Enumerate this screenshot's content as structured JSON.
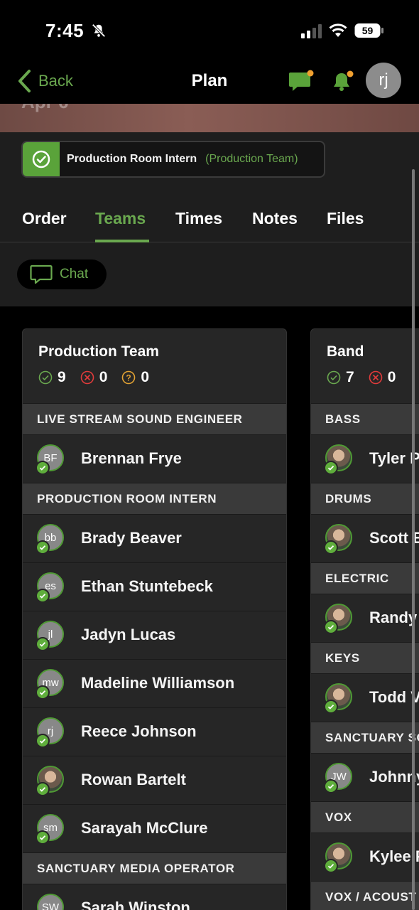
{
  "status_bar": {
    "time": "7:45",
    "battery": "59",
    "icons": [
      "bell-slash-icon",
      "signal-icon",
      "wifi-icon",
      "battery-icon"
    ]
  },
  "nav": {
    "back_label": "Back",
    "title": "Plan",
    "avatar_initials": "rj",
    "icons": [
      "chevron-left-icon",
      "chat-icon",
      "bell-icon"
    ]
  },
  "hero": {
    "date_label": "Apr 6"
  },
  "assignment": {
    "role": "Production Room Intern",
    "team": "(Production Team)"
  },
  "tabs": [
    {
      "label": "Order"
    },
    {
      "label": "Teams",
      "active": true
    },
    {
      "label": "Times"
    },
    {
      "label": "Notes"
    },
    {
      "label": "Files"
    }
  ],
  "chat_button": {
    "label": "Chat"
  },
  "colors": {
    "accent": "#6aa84f",
    "declined": "#e03b3b",
    "pending": "#e0a133",
    "background": "#1e1e1e",
    "card": "#262626",
    "section": "#3a3a3a"
  },
  "teams": [
    {
      "name": "Production Team",
      "counts": {
        "confirmed": "9",
        "declined": "0",
        "pending": "0"
      },
      "sections": [
        {
          "title": "LIVE STREAM SOUND ENGINEER",
          "people": [
            {
              "initials": "BF",
              "name": "Brennan Frye"
            }
          ]
        },
        {
          "title": "PRODUCTION ROOM INTERN",
          "people": [
            {
              "initials": "bb",
              "name": "Brady Beaver"
            },
            {
              "initials": "es",
              "name": "Ethan Stuntebeck"
            },
            {
              "initials": "jl",
              "name": "Jadyn Lucas"
            },
            {
              "initials": "mw",
              "name": "Madeline Williamson"
            },
            {
              "initials": "rj",
              "name": "Reece Johnson"
            },
            {
              "initials": "",
              "name": "Rowan Bartelt"
            },
            {
              "initials": "sm",
              "name": "Sarayah McClure"
            }
          ]
        },
        {
          "title": "SANCTUARY MEDIA OPERATOR",
          "people": [
            {
              "initials": "SW",
              "name": "Sarah Winston"
            }
          ]
        }
      ]
    },
    {
      "name": "Band",
      "counts": {
        "confirmed": "7",
        "declined": "0"
      },
      "sections": [
        {
          "title": "BASS",
          "people": [
            {
              "initials": "",
              "name": "Tyler P"
            }
          ]
        },
        {
          "title": "DRUMS",
          "people": [
            {
              "initials": "",
              "name": "Scott E"
            }
          ]
        },
        {
          "title": "ELECTRIC",
          "people": [
            {
              "initials": "",
              "name": "Randy"
            }
          ]
        },
        {
          "title": "KEYS",
          "people": [
            {
              "initials": "",
              "name": "Todd V"
            }
          ]
        },
        {
          "title": "SANCTUARY SO",
          "people": [
            {
              "initials": "JW",
              "name": "Johnny"
            }
          ]
        },
        {
          "title": "VOX",
          "people": [
            {
              "initials": "",
              "name": "Kylee F"
            }
          ]
        },
        {
          "title": "VOX / ACOUST",
          "people": []
        }
      ]
    }
  ]
}
